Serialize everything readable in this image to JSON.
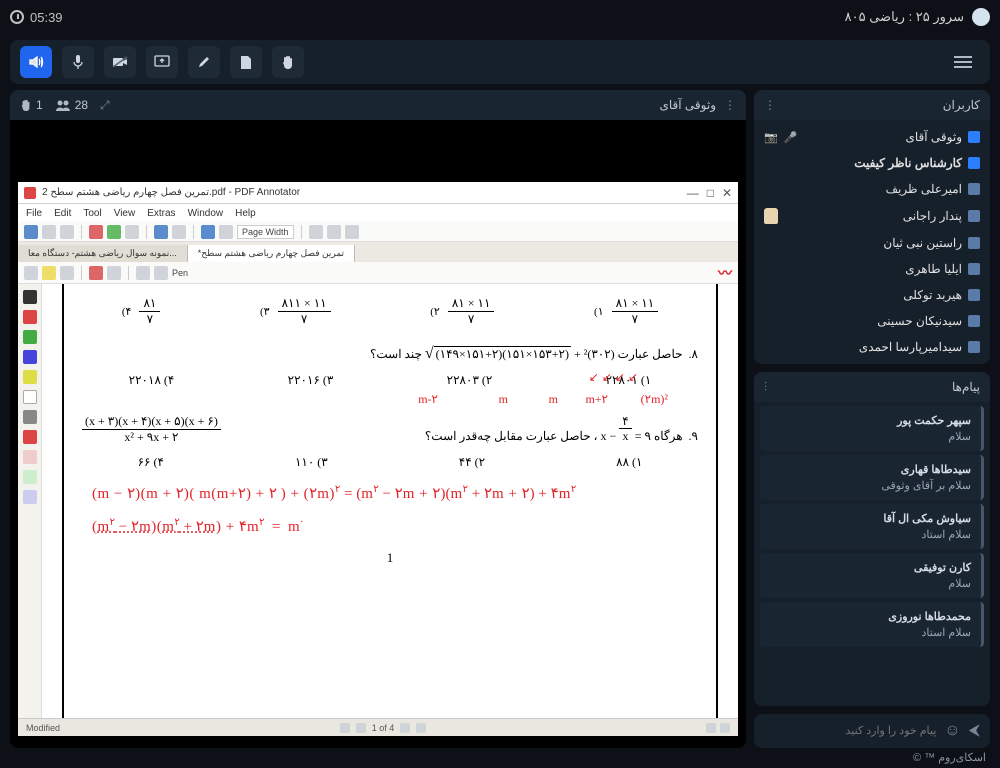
{
  "header": {
    "server_label": "سرور ۲۵ : ریاضی ۸۰۵",
    "timer": "05:39"
  },
  "users_panel": {
    "title": "کاربران",
    "users": [
      {
        "name": "وثوقی آقای",
        "mic": true
      },
      {
        "name": "کارشناس ناظر کیفیت",
        "bold": true
      },
      {
        "name": "امیرعلی ظریف"
      },
      {
        "name": "پندار راجانی",
        "hand": true
      },
      {
        "name": "راستین نبی ثیان"
      },
      {
        "name": "ایلیا طاهری"
      },
      {
        "name": "هیربد توکلی"
      },
      {
        "name": "سیدنیکان حسینی"
      },
      {
        "name": "سیدامیرپارسا احمدی"
      }
    ]
  },
  "messages_panel": {
    "title": "پیام‌ها",
    "messages": [
      {
        "name": "سپهر حکمت پور",
        "text": "سلام"
      },
      {
        "name": "سیدطاها قهاری",
        "text": "سلام بر آقای وثوقی"
      },
      {
        "name": "سیاوش مکی ال آقا",
        "text": "سلام استاد"
      },
      {
        "name": "کارن توفیقی",
        "text": "سلام"
      },
      {
        "name": "محمدطاها نوروزی",
        "text": "سلام استاد"
      }
    ],
    "input_placeholder": "پیام خود را وارد کنید"
  },
  "content": {
    "presenter_name": "وثوقی آقای",
    "hand_count": "1",
    "people_count": "28"
  },
  "pdf": {
    "app_title": "تمرین فصل چهارم ریاضی هشتم سطح 2.pdf - PDF Annotator",
    "menus": [
      "File",
      "Edit",
      "Tool",
      "View",
      "Extras",
      "Window",
      "Help"
    ],
    "page_width_label": "Page Width",
    "tabs": [
      "نمونه سوال ریاضی هشتم- دستگاه معا...",
      "*تمرین فصل چهارم ریاضی هشتم سطح"
    ],
    "pen_label": "Pen",
    "status_left": "Modified",
    "page_indicator": "1 of 4",
    "questions": {
      "top_fracs": [
        {
          "num": "۱۱ × ۸۱",
          "den": "۷",
          "opt": "۱)"
        },
        {
          "num": "۱۱ × ۸۱",
          "den": "۷",
          "opt": "۲)"
        },
        {
          "num": "۱۱ × ۸۱۱",
          "den": "۷",
          "opt": "۳)"
        },
        {
          "num": "۸۱",
          "den": "۷",
          "opt": "۴)"
        }
      ],
      "q8_label": "۸.",
      "q8_text": "حاصل عبارت",
      "q8_expr": "√( (۱۴۹×۱۵۱+۲)(۱۵۱×۱۵۳+۲) ) + (۳۰۲)²",
      "q8_suffix": "چند است؟",
      "q8_opts": [
        "۱) ۲۲۸۰۱",
        "۲) ۲۲۸۰۳",
        "۳) ۲۲۰۱۶",
        "۴) ۲۲۰۱۸"
      ],
      "q9_label": "۹.",
      "q9_text_a": "هرگاه",
      "q9_eq": "۹ = x − ۴/x",
      "q9_text_b": "، حاصل عبارت مقابل چه‌قدر است؟",
      "q9_expr_num": "(x + ۳)(x + ۴)(x + ۵)(x + ۶)",
      "q9_expr_den": "x² + ۹x + ۲",
      "q9_opts": [
        "۱) ۸۸",
        "۲) ۴۴",
        "۳) ۱۱۰",
        "۴) ۶۶"
      ],
      "annot_labels": [
        "m-۲",
        "m",
        "m",
        "m+۲",
        "(۲m)²"
      ],
      "eq1": "(m − ۲)(m + ۲)( m(m+۲) + ۲ ) + (۲m)² = (m² − ۲m + ۲)(m² + ۲m + ۲) + ۴m²",
      "eq2": "(m² − ۲m)(m² + ۲m) + ۴m²  =  m",
      "page_num": "1"
    }
  },
  "footer": "اسکای‌روم ™ ©"
}
